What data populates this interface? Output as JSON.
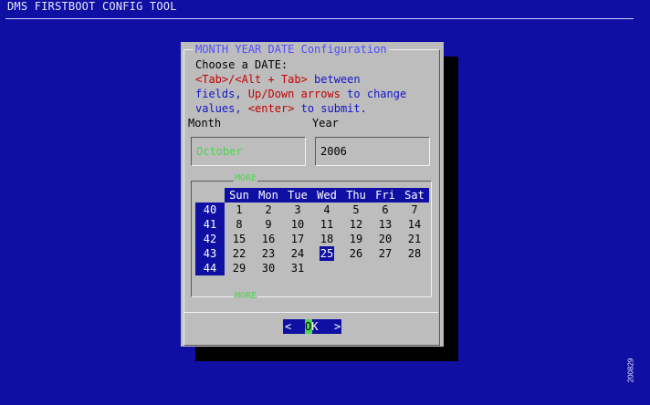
{
  "app": {
    "title": "DMS FIRSTBOOT CONFIG TOOL"
  },
  "dialog": {
    "title": "MONTH  YEAR DATE Configuration",
    "prompt": "Choose a DATE:",
    "help": {
      "keys1": "<Tab>/<Alt + Tab>",
      "text1": " between",
      "text2a": "fields, ",
      "keys2": "Up/Down arrows",
      "text2b": " to change",
      "text3a": "values, ",
      "keys3": "<enter>",
      "text3b": " to submit."
    },
    "month_label": "Month",
    "year_label": "Year",
    "month_value": "October",
    "year_value": "2006",
    "more_top": "MORE",
    "more_bottom": "MORE",
    "calendar": {
      "days_of_week": [
        "Sun",
        "Mon",
        "Tue",
        "Wed",
        "Thu",
        "Fri",
        "Sat"
      ],
      "weeks": [
        {
          "week": "40",
          "days": [
            "1",
            "2",
            "3",
            "4",
            "5",
            "6",
            "7"
          ]
        },
        {
          "week": "41",
          "days": [
            "8",
            "9",
            "10",
            "11",
            "12",
            "13",
            "14"
          ]
        },
        {
          "week": "42",
          "days": [
            "15",
            "16",
            "17",
            "18",
            "19",
            "20",
            "21"
          ]
        },
        {
          "week": "43",
          "days": [
            "22",
            "23",
            "24",
            "25",
            "26",
            "27",
            "28"
          ]
        },
        {
          "week": "44",
          "days": [
            "29",
            "30",
            "31",
            "",
            "",
            "",
            ""
          ]
        }
      ],
      "selected_day": "25"
    },
    "ok_button": {
      "left": "<",
      "o": "O",
      "k": "K",
      "right": ">"
    }
  },
  "figure_id": "200829",
  "colors": {
    "background": "#0f0fa3",
    "dialog": "#bdbdbd",
    "accent_green": "#4fd64f",
    "key_red": "#c40000"
  }
}
